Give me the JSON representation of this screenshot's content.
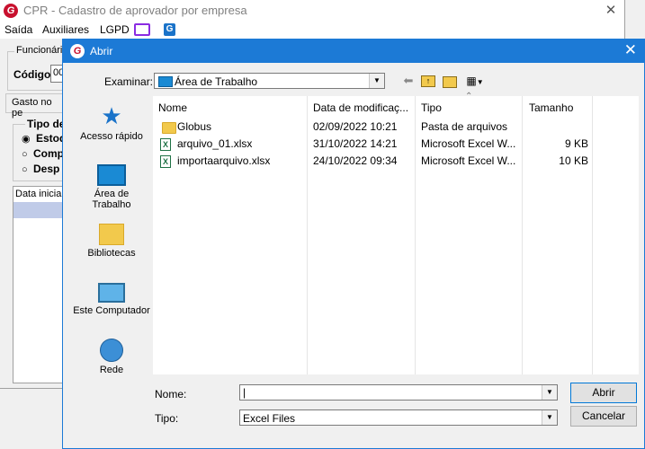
{
  "background_window": {
    "title": "CPR - Cadastro de aprovador por empresa",
    "close_glyph": "✕",
    "logo_letter": "G",
    "menu": [
      "Saída",
      "Auxiliares",
      "LGPD"
    ],
    "app_icon_letter": "G",
    "group_funcionario": "Funcionári",
    "codigo_label": "Código",
    "codigo_value": "00",
    "gasto_label": "Gasto no pe",
    "tipo_group": "Tipo de",
    "radios": [
      "Estoq",
      "Comp",
      "Desp"
    ],
    "grid_header": "Data inicial"
  },
  "dialog": {
    "title": "Abrir",
    "logo_letter": "G",
    "close_glyph": "✕",
    "examinar_label": "Examinar:",
    "examinar_value": "Área de Trabalho",
    "toolbar_icons": [
      "back-icon",
      "up-folder-icon",
      "new-folder-icon",
      "view-menu-icon"
    ],
    "places": [
      {
        "label": "Acesso rápido",
        "icon": "star-icon"
      },
      {
        "label": "Área de\nTrabalho",
        "icon": "desktop-icon"
      },
      {
        "label": "Bibliotecas",
        "icon": "libraries-icon"
      },
      {
        "label": "Este Computador",
        "icon": "computer-icon"
      },
      {
        "label": "Rede",
        "icon": "network-icon"
      }
    ],
    "columns": {
      "name": "Nome",
      "date": "Data de modificaç...",
      "type": "Tipo",
      "size": "Tamanho"
    },
    "files": [
      {
        "name": "Globus",
        "date": "02/09/2022 10:21",
        "type": "Pasta de arquivos",
        "size": "",
        "icon": "folder-icon"
      },
      {
        "name": "arquivo_01.xlsx",
        "date": "31/10/2022 14:21",
        "type": "Microsoft Excel W...",
        "size": "9 KB",
        "icon": "excel-icon"
      },
      {
        "name": "importaarquivo.xlsx",
        "date": "24/10/2022 09:34",
        "type": "Microsoft Excel W...",
        "size": "10 KB",
        "icon": "excel-icon"
      }
    ],
    "nome_label": "Nome:",
    "nome_value": "",
    "tipo_label": "Tipo:",
    "tipo_value": "Excel Files",
    "open_button": "Abrir",
    "cancel_button": "Cancelar"
  }
}
